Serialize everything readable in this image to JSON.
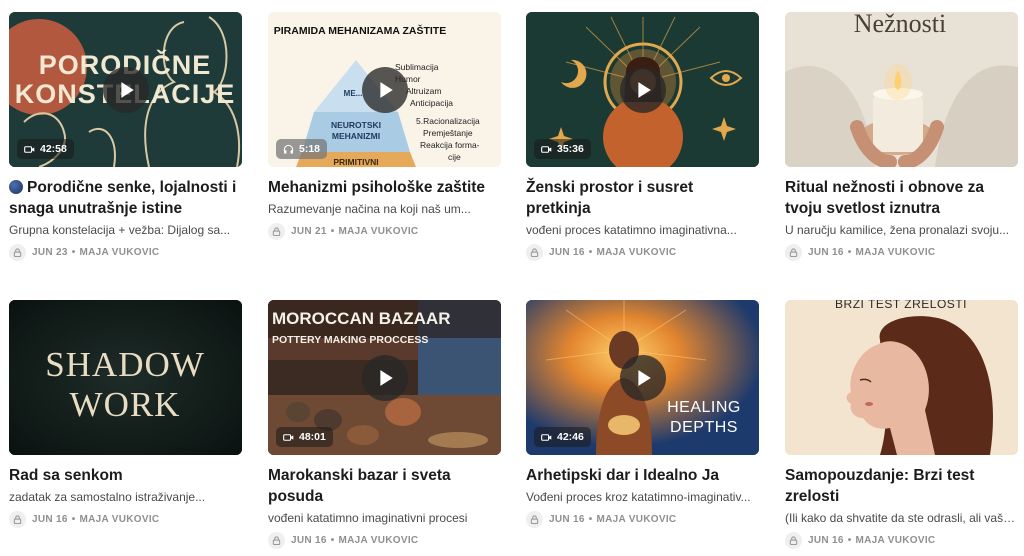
{
  "posts": [
    {
      "thumb_text": [
        "PORODIČNE",
        "KONSTELACIJE"
      ],
      "duration": "42:58",
      "media_icon": "video-icon",
      "title": "Porodične senke, lojalnosti i snaga unutrašnje istine",
      "subtitle": "Grupna konstelacija + vežba: Dijalog sa...",
      "date": "JUN 23",
      "author": "MAJA VUKOVIC"
    },
    {
      "thumb_text": {
        "heading": "PIRAMIDA MEHANIZAMA ZAŠTITE",
        "list1": [
          "Sublimacija",
          "Humor",
          "Altruizam",
          "Anticipacija"
        ],
        "tier1": "ME...",
        "tier2": [
          "NEUROTSKI",
          "MEHANIZMI"
        ],
        "tier3": "PRIMITIVNI",
        "list2": [
          "5.Racionalizacija",
          "Premještanje",
          "Reakcija forma-",
          "cije"
        ]
      },
      "duration": "5:18",
      "media_icon": "headphones-icon",
      "title": "Mehanizmi psihološke zaštite",
      "subtitle": "Razumevanje načina na koji naš um...",
      "date": "JUN 21",
      "author": "MAJA VUKOVIC"
    },
    {
      "duration": "35:36",
      "media_icon": "video-icon",
      "title": "Ženski prostor i susret pretkinja",
      "subtitle": "vođeni proces katatimno imaginativna...",
      "date": "JUN 16",
      "author": "MAJA VUKOVIC"
    },
    {
      "thumb_text": [
        "Nežnosti"
      ],
      "title": "Ritual nežnosti i obnove za tvoju svetlost iznutra",
      "subtitle": "U naručju kamilice, žena pronalazi svoju...",
      "date": "JUN 16",
      "author": "MAJA VUKOVIC"
    },
    {
      "thumb_text": [
        "SHADOW",
        "WORK"
      ],
      "title": "Rad sa senkom",
      "subtitle": "zadatak za samostalno istraživanje...",
      "date": "JUN 16",
      "author": "MAJA VUKOVIC"
    },
    {
      "thumb_text": [
        "MOROCCAN BAZAAR",
        "POTTERY MAKING PROCCESS"
      ],
      "duration": "48:01",
      "media_icon": "video-icon",
      "title": "Marokanski bazar i sveta posuda",
      "subtitle": "vođeni katatimno imaginativni procesi",
      "date": "JUN 16",
      "author": "MAJA VUKOVIC"
    },
    {
      "thumb_text": [
        "HEALING",
        "DEPTHS"
      ],
      "duration": "42:46",
      "media_icon": "video-icon",
      "title": "Arhetipski dar i Idealno Ja",
      "subtitle": "Vođeni proces kroz katatimno-imaginativ...",
      "date": "JUN 16",
      "author": "MAJA VUKOVIC"
    },
    {
      "thumb_text": [
        "BRZI TEST ZRELOSTI"
      ],
      "title": "Samopouzdanje: Brzi test zrelosti",
      "subtitle": "(Ili kako da shvatite da ste odrasli, ali vaša...",
      "date": "JUN 16",
      "author": "MAJA VUKOVIC"
    }
  ],
  "separator": "•",
  "icons": {
    "play": "play-icon",
    "lock": "lock-icon",
    "video": "video-icon",
    "audio": "headphones-icon"
  }
}
